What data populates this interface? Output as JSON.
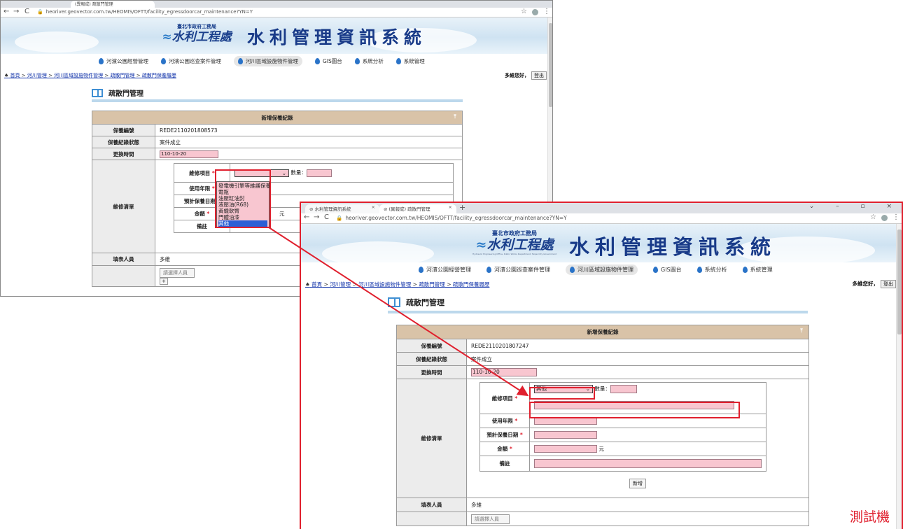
{
  "back_window": {
    "tab_active_text": "(異報成) 疏散門管理",
    "url": "heoriver.geovector.com.tw/HEOMIS/OFTT/facility_egressdoorcar_maintenance?YN=Y",
    "brand_small": "臺北市政府工務局",
    "brand_big": "水利工程處",
    "system_title": "水利管理資訊系統",
    "nav": [
      "河濱公園經營管理",
      "河濱公園巡查案件管理",
      "河川區域設施物件管理",
      "GIS圖台",
      "系統分析",
      "系統管理"
    ],
    "breadcrumb": [
      "首頁",
      "河川管理",
      "河川區域設施物件管理",
      "疏散門管理",
      "疏散門保養履歷"
    ],
    "greeting": "多維您好，",
    "logout": "登出",
    "page_title": "疏散門管理",
    "form_title": "新增保養紀錄",
    "rows": {
      "record_no_label": "保養編號",
      "record_no": "REDE2110201808573",
      "status_label": "保養紀錄狀態",
      "status": "案件成立",
      "time_label": "更換時間",
      "time": "110-10-20",
      "list_label": "維修清單",
      "filler_label": "填表人員",
      "filler": "多維"
    },
    "item_label": "維修項目",
    "qty_label": "數量：",
    "years_label": "使用年限",
    "date_label": "預計保養日期",
    "amount_label": "金額",
    "note_label": "備註",
    "unit": "元",
    "dropdown_options": [
      "發電機引擎等維護保養",
      "電瓶",
      "油壓缸油封",
      "液壓油(R68)",
      "黃蠟軟臂",
      "門體油漆",
      "其他"
    ],
    "add_person": "請選擇人員"
  },
  "front_window": {
    "tab1": "水利管理資訊系統",
    "tab2": "(異報成) 疏散門管理",
    "url": "heoriver.geovector.com.tw/HEOMIS/OFTT/facility_egressdoorcar_maintenance?YN=Y",
    "brand_small": "臺北市政府工務局",
    "brand_big": "水利工程處",
    "brand_sub": "Hydraulic Engineering Office, Public Works Department, Taipei City Government",
    "system_title": "水利管理資訊系統",
    "nav": [
      "河濱公園經營管理",
      "河濱公園巡查案件管理",
      "河川區域設施物件管理",
      "GIS圖台",
      "系統分析",
      "系統管理"
    ],
    "breadcrumb": [
      "首頁",
      "河川管理",
      "河川區域設施物件管理",
      "疏散門管理",
      "疏散門保養履歷"
    ],
    "greeting": "多維您好，",
    "logout": "登出",
    "page_title": "疏散門管理",
    "form_title": "新增保養紀錄",
    "rows": {
      "record_no_label": "保養編號",
      "record_no": "REDE2110201807247",
      "status_label": "保養紀錄狀態",
      "status": "案件成立",
      "time_label": "更換時間",
      "time": "110-10-20",
      "list_label": "維修清單",
      "filler_label": "填表人員",
      "filler": "多維"
    },
    "item_label": "維修項目",
    "item_selected": "其他",
    "qty_label": "數量：",
    "years_label": "使用年限",
    "date_label": "預計保養日期",
    "amount_label": "金額",
    "note_label": "備註",
    "unit": "元",
    "add_button": "新增",
    "add_person": "請選擇人員"
  },
  "watermark": "測試機",
  "colors": {
    "accent_red": "#e0202e",
    "pink_input": "#f8c6d0",
    "header_tan": "#d9c3a8",
    "title_blue": "#183a88"
  }
}
